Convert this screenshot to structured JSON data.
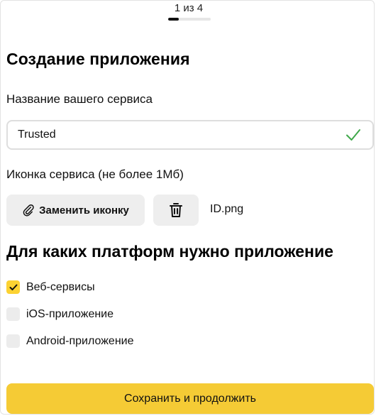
{
  "stepper": {
    "text": "1 из 4",
    "progress_fraction": 0.25
  },
  "title": "Создание приложения",
  "service_name": {
    "label": "Название вашего сервиса",
    "value": "Trusted",
    "status_icon": "check-icon",
    "status_color": "#3fa84a"
  },
  "service_icon": {
    "label": "Иконка сервиса (не более 1Мб)",
    "replace_button": "Заменить иконку",
    "replace_icon": "paperclip-icon",
    "delete_icon": "trash-icon",
    "file_name": "ID.png"
  },
  "platforms": {
    "title": "Для каких платформ нужно приложение",
    "options": [
      {
        "label": "Веб-сервисы",
        "checked": true
      },
      {
        "label": "iOS-приложение",
        "checked": false
      },
      {
        "label": "Android-приложение",
        "checked": false
      }
    ]
  },
  "submit_button": "Сохранить и продолжить",
  "colors": {
    "accent": "#f5cb35",
    "button_gray": "#eeeeee",
    "checkbox_checked": "#fcd232"
  }
}
